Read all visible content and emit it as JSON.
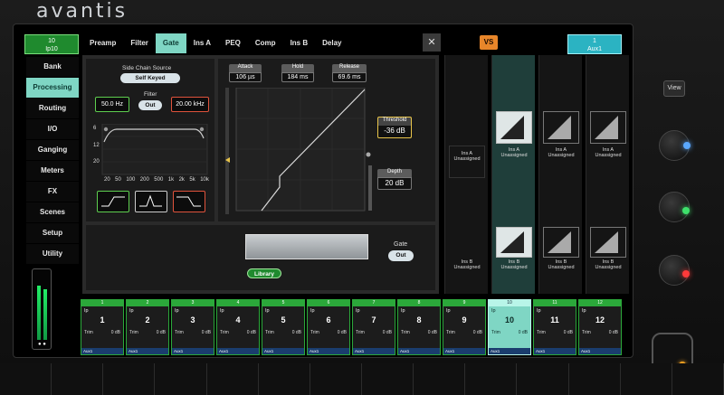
{
  "brand": "avantis",
  "header": {
    "channel_num": "10",
    "channel_name": "Ip10",
    "tabs": [
      "Preamp",
      "Filter",
      "Gate",
      "Ins A",
      "PEQ",
      "Comp",
      "Ins B",
      "Delay"
    ],
    "active_tab": "Gate",
    "close_icon": "✕",
    "vs_label": "VS",
    "aux_num": "1",
    "aux_name": "Aux1"
  },
  "sidebar": {
    "items": [
      "Bank",
      "Processing",
      "Routing",
      "I/O",
      "Ganging",
      "Meters",
      "FX",
      "Scenes",
      "Setup",
      "Utility"
    ],
    "active": "Processing"
  },
  "gate": {
    "side_chain_title": "Side Chain Source",
    "side_chain_value": "Self Keyed",
    "filter_label": "Filter",
    "filter_state": "Out",
    "hpf_value": "50.0 Hz",
    "lpf_value": "20.00 kHz",
    "graph_y_labels": [
      "6",
      "12",
      "20"
    ],
    "graph_x_labels": [
      "20",
      "50",
      "100",
      "200",
      "500",
      "1k",
      "2k",
      "5k",
      "10k"
    ],
    "attack_label": "Attack",
    "attack_value": "106 µs",
    "hold_label": "Hold",
    "hold_value": "184 ms",
    "release_label": "Release",
    "release_value": "69.6 ms",
    "threshold_label": "Threshold",
    "threshold_value": "-36 dB",
    "depth_label": "Depth",
    "depth_value": "20 dB",
    "library_label": "Library",
    "gate_label": "Gate",
    "gate_state": "Out"
  },
  "strips": [
    {
      "ins_a": "Ins A",
      "ins_a_state": "Unassigned",
      "ins_b": "Ins B",
      "ins_b_state": "Unassigned"
    },
    {
      "ins_a": "Ins A",
      "ins_a_state": "Unassigned",
      "ins_b": "Ins B",
      "ins_b_state": "Unassigned"
    },
    {
      "ins_a": "Ins A",
      "ins_a_state": "Unassigned",
      "ins_b": "Ins B",
      "ins_b_state": "Unassigned"
    },
    {
      "ins_a": "Ins A",
      "ins_a_state": "Unassigned",
      "ins_b": "Ins B",
      "ins_b_state": "Unassigned"
    }
  ],
  "channels": [
    {
      "num": "1",
      "ip": "Ip",
      "big": "1",
      "trim": "Trim",
      "trim_val": "0 dB",
      "foot": "Aux1"
    },
    {
      "num": "2",
      "ip": "Ip",
      "big": "2",
      "trim": "Trim",
      "trim_val": "0 dB",
      "foot": "Aux1"
    },
    {
      "num": "3",
      "ip": "Ip",
      "big": "3",
      "trim": "Trim",
      "trim_val": "0 dB",
      "foot": "Aux1"
    },
    {
      "num": "4",
      "ip": "Ip",
      "big": "4",
      "trim": "Trim",
      "trim_val": "0 dB",
      "foot": "Aux1"
    },
    {
      "num": "5",
      "ip": "Ip",
      "big": "5",
      "trim": "Trim",
      "trim_val": "0 dB",
      "foot": "Aux1"
    },
    {
      "num": "6",
      "ip": "Ip",
      "big": "6",
      "trim": "Trim",
      "trim_val": "0 dB",
      "foot": "Aux1"
    },
    {
      "num": "7",
      "ip": "Ip",
      "big": "7",
      "trim": "Trim",
      "trim_val": "0 dB",
      "foot": "Aux1"
    },
    {
      "num": "8",
      "ip": "Ip",
      "big": "8",
      "trim": "Trim",
      "trim_val": "0 dB",
      "foot": "Aux1"
    },
    {
      "num": "9",
      "ip": "Ip",
      "big": "9",
      "trim": "Trim",
      "trim_val": "0 dB",
      "foot": "Aux1"
    },
    {
      "num": "10",
      "ip": "Ip",
      "big": "10",
      "trim": "Trim",
      "trim_val": "0 dB",
      "foot": "Aux1"
    },
    {
      "num": "11",
      "ip": "Ip",
      "big": "11",
      "trim": "Trim",
      "trim_val": "0 dB",
      "foot": "Aux1"
    },
    {
      "num": "12",
      "ip": "Ip",
      "big": "12",
      "trim": "Trim",
      "trim_val": "0 dB",
      "foot": "Aux1"
    }
  ],
  "selected_channel": "10",
  "hardware": {
    "view_label": "View"
  },
  "colors": {
    "accent": "#7fd6c4",
    "channel_green": "#2ba83a",
    "vs_orange": "#e8862a",
    "threshold_yellow": "#e8c44a"
  }
}
